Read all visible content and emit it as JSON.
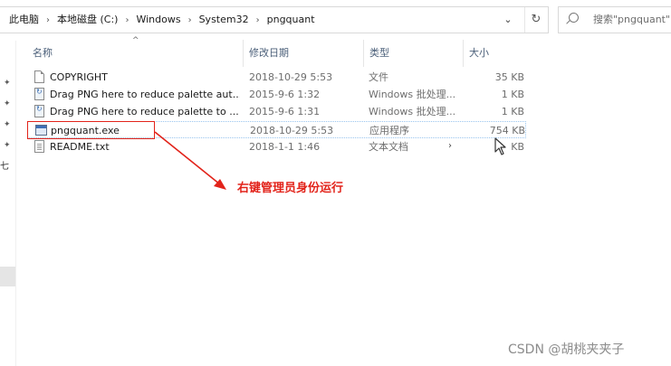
{
  "address": {
    "crumbs": [
      "此电脑",
      "本地磁盘 (C:)",
      "Windows",
      "System32",
      "pngquant"
    ],
    "separator": "›",
    "dropdown_icon": "chevron-down-icon",
    "refresh_icon": "refresh-icon"
  },
  "search": {
    "placeholder": "搜索\"pngquant\""
  },
  "columns": {
    "name": "名称",
    "date": "修改日期",
    "type": "类型",
    "size": "大小",
    "sort_indicator": "^"
  },
  "files": [
    {
      "name": "COPYRIGHT",
      "date": "2018-10-29 5:53",
      "type": "文件",
      "size": "35 KB",
      "icon": "document-icon"
    },
    {
      "name": "Drag PNG here to reduce palette aut...",
      "date": "2015-9-6 1:32",
      "type": "Windows 批处理...",
      "size": "1 KB",
      "icon": "batch-file-icon"
    },
    {
      "name": "Drag PNG here to reduce palette to ...",
      "date": "2015-9-6 1:31",
      "type": "Windows 批处理...",
      "size": "1 KB",
      "icon": "batch-file-icon"
    },
    {
      "name": "pngquant.exe",
      "date": "2018-10-29 5:53",
      "type": "应用程序",
      "size": "754 KB",
      "icon": "exe-icon"
    },
    {
      "name": "README.txt",
      "date": "2018-1-1 1:46",
      "type": "文本文档",
      "size": "KB",
      "icon": "text-file-icon"
    }
  ],
  "annotation": {
    "text": "右键管理员身份运行",
    "color": "#e2231a"
  },
  "left_pane": {
    "label": "七"
  },
  "watermark": "CSDN @胡桃夹夹子",
  "colors": {
    "header_text": "#4c607a",
    "annotation_red": "#e2231a",
    "selection_border": "#99c5ee"
  }
}
